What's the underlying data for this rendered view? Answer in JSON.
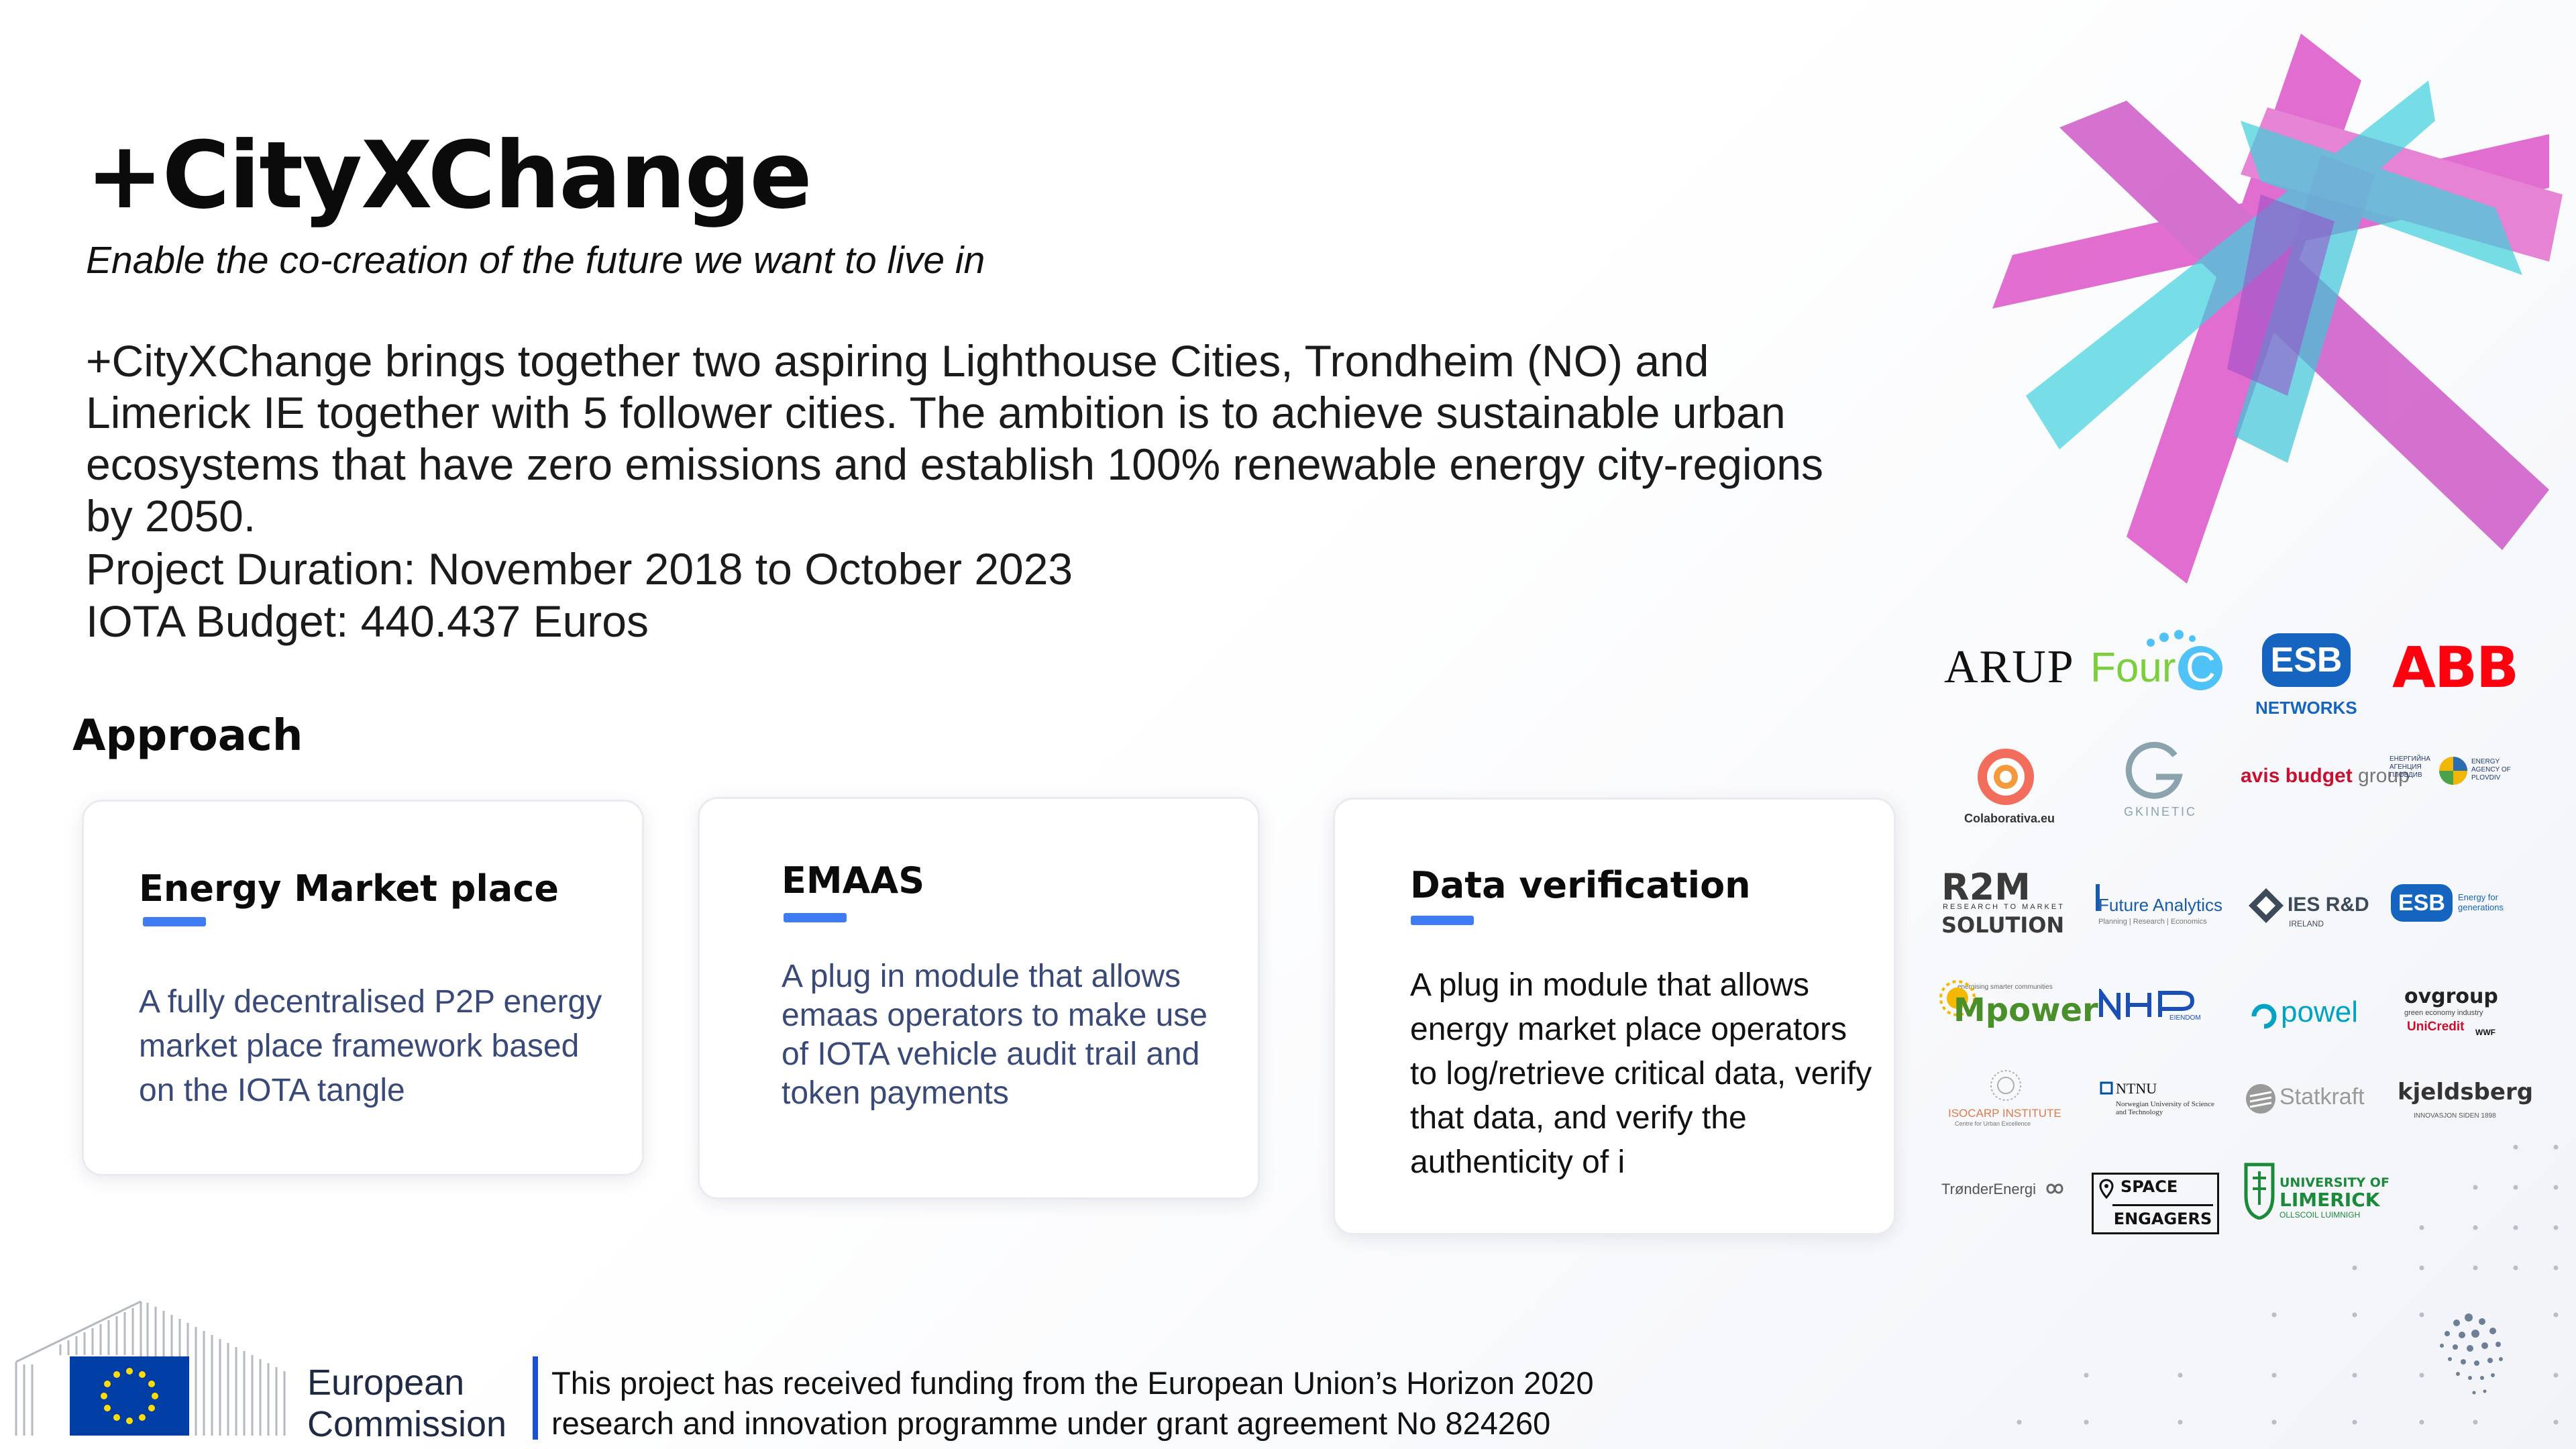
{
  "header": {
    "title": "+CityXChange",
    "tagline": "Enable the co-creation of the future we want to live in",
    "description": "+CityXChange brings together two aspiring Lighthouse Cities, Trondheim (NO) and Limerick IE together with 5 follower cities. The ambition is to achieve sustainable urban ecosystems that have zero emissions and establish 100% renewable energy city-regions by 2050.",
    "duration": "Project Duration: November 2018 to October 2023",
    "budget": "IOTA Budget: 440.437 Euros"
  },
  "approach": {
    "heading": "Approach",
    "cards": [
      {
        "title": "Energy Market place",
        "body": "A fully decentralised P2P energy market place framework based on the IOTA tangle"
      },
      {
        "title": "EMAAS",
        "body": "A plug in module that allows emaas operators to make use of IOTA vehicle audit trail and token payments"
      },
      {
        "title": "Data verification",
        "body": "A plug in module that allows energy market place operators to log/retrieve critical data, verify that data, and verify the authenticity of i"
      }
    ]
  },
  "partners": {
    "arup": "ARUP",
    "fourc_a": "Four",
    "fourc_b": "C",
    "esb_networks": "NETWORKS",
    "abb": "ABB",
    "colaborativa": "Colaborativa.eu",
    "gkinetic": "GKINETIC",
    "avis_a": "avis budget",
    "avis_b": " group",
    "energy_agency_1": "ЕНЕРГИЙНА АГЕНЦИЯ ПЛОВДИВ",
    "energy_agency_2": "ENERGY AGENCY OF PLOVDIV",
    "r2m_a": "R2M",
    "r2m_sub": "RESEARCH TO MARKET",
    "r2m_b": "SOLUTION",
    "future_analytics": "Future Analytics",
    "future_analytics_sub": "Planning | Research | Economics",
    "ies_rd": "IES R&D",
    "ies_sub": "IRELAND",
    "esb_gen": "Energy for generations",
    "mpower_sub": "energising smarter communities",
    "mpower": "Mpower",
    "nhp": "NHP",
    "nhp_sub": "EIENDOM",
    "powel": "powel",
    "ovgroup": "ovgroup",
    "ovgroup_sub": "green economy industry",
    "unicredit": "UniCredit",
    "wwf": "WWF",
    "isocarp": "ISOCARP INSTITUTE",
    "isocarp_sub": "Centre for Urban Excellence",
    "ntnu": "NTNU",
    "ntnu_sub": "Norwegian University of Science and Technology",
    "statkraft": "Statkraft",
    "kjeldsberg": "kjeldsberg",
    "kjeldsberg_sub": "INNOVASJON SIDEN 1898",
    "tronder": "TrønderEnergi",
    "space": "SPACE",
    "engagers": "ENGAGERS",
    "ul_1": "UNIVERSITY OF",
    "ul_2": "LIMERICK",
    "ul_3": "OLLSCOIL LUIMNIGH"
  },
  "footer": {
    "ec_name_1": "European",
    "ec_name_2": "Commission",
    "funding": "This project has received funding from the European Union’s Horizon 2020 research and innovation programme under grant agreement No 824260"
  },
  "colors": {
    "accent_blue": "#3f7cf4",
    "magenta": "#d83ec0",
    "cyan": "#3fd0dc",
    "card_body_blue": "#3a4a78",
    "esb_blue": "#1565c0",
    "abb_red": "#ff000f"
  },
  "icons": [
    "plus-x-logo",
    "eu-flag-icon",
    "ec-building-icon",
    "iota-logo-icon",
    "dot-grid-decoration"
  ]
}
